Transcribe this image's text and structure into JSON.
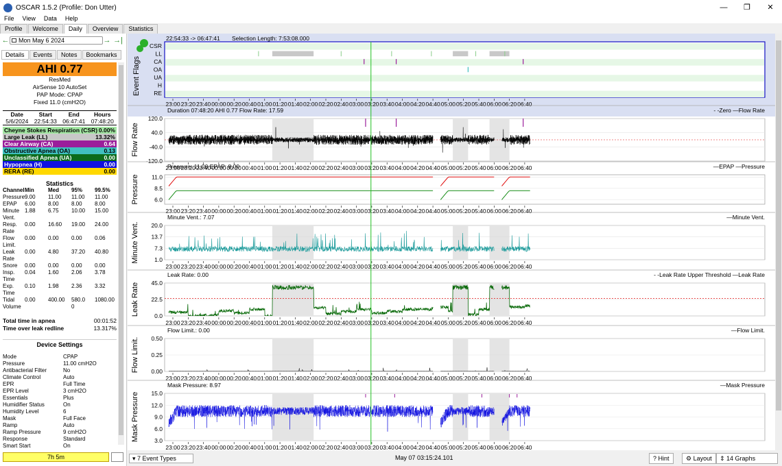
{
  "window": {
    "title": "OSCAR 1.5.2 (Profile: Don Utter)",
    "min": "—",
    "max": "❐",
    "close": "✕"
  },
  "menu": [
    "File",
    "View",
    "Data",
    "Help"
  ],
  "tabs": [
    "Profile",
    "Welcome",
    "Daily",
    "Overview",
    "Statistics"
  ],
  "date": {
    "prev": "←",
    "value": "Mon May 6 2024",
    "next": "→",
    "last": "→|"
  },
  "subtabs": [
    "Details",
    "Events",
    "Notes",
    "Bookmarks"
  ],
  "ahi": "AHI 0.77",
  "machine": [
    "ResMed",
    "AirSense 10 AutoSet",
    "PAP Mode: CPAP",
    "Fixed 11.0 (cmH2O)"
  ],
  "session": {
    "headers": [
      "Date",
      "Start",
      "End",
      "Hours"
    ],
    "values": [
      "5/6/2024",
      "22:54:33",
      "06:47:41",
      "07:48:20"
    ]
  },
  "events": [
    {
      "name": "Cheyne Stokes Respiration (CSR)",
      "value": "0.00%",
      "bg": "#a3e7a3",
      "fg": "#000"
    },
    {
      "name": "Large Leak (LL)",
      "value": "13.32%",
      "bg": "#c8c8c8",
      "fg": "#000"
    },
    {
      "name": "Clear Airway (CA)",
      "value": "0.64",
      "bg": "#9b1e9b",
      "fg": "#fff"
    },
    {
      "name": "Obstructive Apnea (OA)",
      "value": "0.13",
      "bg": "#40c0c0",
      "fg": "#000"
    },
    {
      "name": "Unclassified Apnea (UA)",
      "value": "0.00",
      "bg": "#0b6b1b",
      "fg": "#fff"
    },
    {
      "name": "Hypopnea (H)",
      "value": "0.00",
      "bg": "#1010e0",
      "fg": "#fff"
    },
    {
      "name": "RERA (RE)",
      "value": "0.00",
      "bg": "#ffd800",
      "fg": "#000"
    }
  ],
  "stats": {
    "title": "Statistics",
    "headers": [
      "Channel",
      "Min",
      "Med",
      "95%",
      "99.5%"
    ],
    "rows": [
      [
        "Pressure",
        "9.00",
        "11.00",
        "11.00",
        "11.00"
      ],
      [
        "EPAP",
        "6.00",
        "8.00",
        "8.00",
        "8.00"
      ],
      [
        "Minute",
        "1.88",
        "6.75",
        "10.00",
        "15.00"
      ],
      [
        "Vent.",
        "",
        "",
        "",
        ""
      ],
      [
        "Resp.",
        "0.00",
        "16.60",
        "19.00",
        "24.00"
      ],
      [
        "Rate",
        "",
        "",
        "",
        ""
      ],
      [
        "Flow",
        "0.00",
        "0.00",
        "0.00",
        "0.06"
      ],
      [
        "Limit.",
        "",
        "",
        "",
        ""
      ],
      [
        "Leak Rate",
        "0.00",
        "4.80",
        "37.20",
        "40.80"
      ],
      [
        "Snore",
        "0.00",
        "0.00",
        "0.00",
        "0.00"
      ],
      [
        "Insp.",
        "0.04",
        "1.60",
        "2.06",
        "3.78"
      ],
      [
        "Time",
        "",
        "",
        "",
        ""
      ],
      [
        "Exp.",
        "0.10",
        "1.98",
        "2.36",
        "3.32"
      ],
      [
        "Time",
        "",
        "",
        "",
        ""
      ],
      [
        "Tidal",
        "0.00",
        "400.00",
        "580.0",
        "1080.00"
      ],
      [
        "Volume",
        "",
        "",
        "0",
        ""
      ]
    ]
  },
  "totals": [
    [
      "Total time in apnea",
      "00:01:52"
    ],
    [
      "Time over leak redline",
      "13.317%"
    ]
  ],
  "device": {
    "title": "Device Settings",
    "rows": [
      [
        "Mode",
        "CPAP"
      ],
      [
        "Pressure",
        "11.00 cmH2O"
      ],
      [
        "Antibacterial Filter",
        "No"
      ],
      [
        "Climate Control",
        "Auto"
      ],
      [
        "EPR",
        "Full Time"
      ],
      [
        "EPR Level",
        "3 cmH2O"
      ],
      [
        "Essentials",
        "Plus"
      ],
      [
        "Humidifier Status",
        "On"
      ],
      [
        "Humidity Level",
        "6"
      ],
      [
        "Mask",
        "Full Face"
      ],
      [
        "Ramp",
        "Auto"
      ],
      [
        "Ramp Pressure",
        "9 cmH2O"
      ],
      [
        "Response",
        "Standard"
      ],
      [
        "Smart Start",
        "On"
      ]
    ]
  },
  "sleep_time": "7h 5m",
  "flags_header": {
    "range": "22:54:33 -> 06:47:41",
    "selection": "Selection Length: 7:53:08.000"
  },
  "flag_labels": [
    "CSR",
    "LL",
    "CA",
    "OA",
    "UA",
    "H",
    "RE"
  ],
  "time_ticks": [
    "23:00",
    "23:20",
    "23:40",
    "00:00",
    "00:20",
    "00:40",
    "01:00",
    "01:20",
    "01:40",
    "02:00",
    "02:20",
    "02:40",
    "03:00",
    "03:20",
    "03:40",
    "04:00",
    "04:20",
    "04:40",
    "05:00",
    "05:20",
    "05:40",
    "06:00",
    "06:20",
    "06:40"
  ],
  "graphs": [
    {
      "id": "flow",
      "title": "Flow Rate",
      "header": "Duration 07:48:20 AHI 0.77 Flow Rate: 17.59",
      "legend": "- -Zero —Flow Rate",
      "yticks": [
        "120.0",
        "40.0",
        "-40.0",
        "-120.0"
      ],
      "ymin": -120,
      "ymax": 120
    },
    {
      "id": "pressure",
      "title": "Pressure",
      "header": "Pressure: 11.00 EPAP: 8.00",
      "legend": "—EPAP —Pressure",
      "yticks": [
        "11.0",
        "8.5",
        "6.0"
      ],
      "ymin": 5,
      "ymax": 11.5
    },
    {
      "id": "minvent",
      "title": "Minute Vent.",
      "header": "Minute Vent.: 7.07",
      "legend": "—Minute Vent.",
      "yticks": [
        "20.0",
        "13.7",
        "7.3",
        "1.0"
      ],
      "ymin": 1,
      "ymax": 20
    },
    {
      "id": "leak",
      "title": "Leak Rate",
      "header": "Leak Rate: 0.00",
      "legend": "- -Leak Rate Upper Threshold —Leak Rate",
      "yticks": [
        "45.0",
        "22.5",
        "0.0"
      ],
      "ymin": 0,
      "ymax": 45
    },
    {
      "id": "flowlim",
      "title": "Flow Limit.",
      "header": "Flow Limit.: 0.00",
      "legend": "—Flow Limit.",
      "yticks": [
        "0.50",
        "0.25",
        "0.00"
      ],
      "ymin": 0,
      "ymax": 0.5
    },
    {
      "id": "mask",
      "title": "Mask Pressure",
      "header": "Mask Pressure: 8.97",
      "legend": "—Mask Pressure",
      "yticks": [
        "15.0",
        "12.0",
        "9.0",
        "6.0",
        "3.0"
      ],
      "ymin": 3,
      "ymax": 15
    }
  ],
  "colors": {
    "flow": "#000000",
    "epap": "#138a13",
    "pressure": "#e01010",
    "minvent": "#1a9a9a",
    "leak": "#0a6a0a",
    "mask": "#1010e0",
    "threshold": "#e01010",
    "cursor": "#20c020",
    "ll": "#c8c8c8"
  },
  "statusbar": {
    "events": "7 Event Types",
    "time": "May 07 03:15:24.101",
    "hint": "Hint",
    "layout": "Layout",
    "graphs": "14 Graphs"
  }
}
